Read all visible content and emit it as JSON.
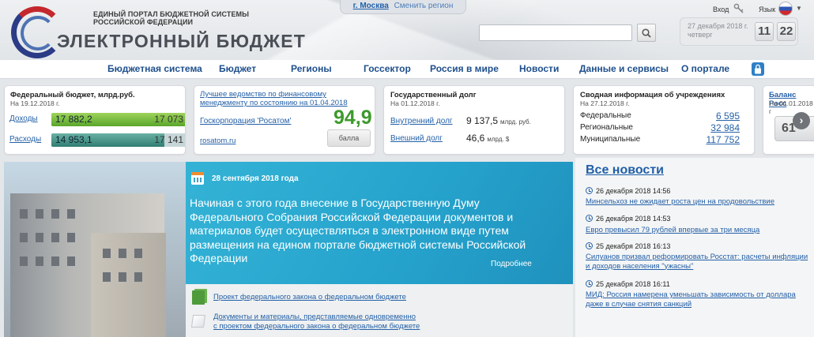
{
  "header": {
    "portal_line1": "ЕДИНЫЙ ПОРТАЛ БЮДЖЕТНОЙ СИСТЕМЫ",
    "portal_line2": "РОССИЙСКОЙ ФЕДЕРАЦИИ",
    "brand": "ЭЛЕКТРОННЫЙ БЮДЖЕТ",
    "region_city": "г. Москва",
    "region_change": "Сменить регион",
    "search_placeholder": "",
    "date": "27 декабря 2018 г.",
    "weekday": "четверг",
    "clock_hours": "11",
    "clock_minutes": "22",
    "login": "Вход",
    "language": "Язык",
    "icons": [
      "search-icon",
      "key-icon",
      "flag-icon",
      "lock-icon"
    ]
  },
  "nav": {
    "items": [
      "Бюджетная система",
      "Бюджет",
      "Регионы",
      "Госсектор",
      "Россия в мире",
      "Новости",
      "Данные и сервисы",
      "О портале"
    ]
  },
  "cards": {
    "federal": {
      "title": "Федеральный бюджет, млрд.руб.",
      "date": "На 19.12.2018 г.",
      "income_label": "Доходы",
      "income_actual": "17 882,2",
      "income_plan": "17 073",
      "income_fill_pct": 100,
      "expense_label": "Расходы",
      "expense_actual": "14 953,1",
      "expense_plan": "17 141",
      "expense_fill_pct": 83
    },
    "ministry": {
      "title": "Лучшее ведомство по финансовому менеджменту по состоянию на 01.04.2018",
      "org": "Госкорпорация 'Росатом'",
      "score": "94,9",
      "score_unit": "балла",
      "site": "rosatom.ru"
    },
    "debt": {
      "title": "Государственный долг",
      "date": "На 01.12.2018 г.",
      "internal_label": "Внутренний долг",
      "internal_value": "9 137,5",
      "internal_unit": "млрд. руб.",
      "external_label": "Внешний долг",
      "external_value": "46,6",
      "external_unit": "млрд. $"
    },
    "institutions": {
      "title": "Сводная информация об учреждениях",
      "date": "На 27.12.2018 г.",
      "rows": [
        {
          "label": "Федеральные",
          "value": "6 595"
        },
        {
          "label": "Региональные",
          "value": "32 984"
        },
        {
          "label": "Муниципальные",
          "value": "117 752"
        }
      ]
    },
    "balance": {
      "title": "Баланс Росс",
      "date": "На 01.01.2018 г",
      "digits": "61",
      "next_arrow": "›"
    }
  },
  "banner": {
    "date": "28 сентября 2018 года",
    "text": "Начиная с этого года внесение в Государственную Думу Федерального Собрания Российской Федерации документов и материалов будет осуществляться в электронном виде путем размещения на едином портале бюджетной системы Российской Федерации",
    "more": "Подробнее"
  },
  "documents": {
    "link1": "Проект федерального закона о федеральном бюджете",
    "link2_line1": "Документы и материалы, представляемые одновременно",
    "link2_line2": "с проектом федерального закона о федеральном бюджете"
  },
  "news": {
    "heading": "Все новости",
    "items": [
      {
        "time": "26 декабря 2018 14:56",
        "title": "Минсельхоз не ожидает роста цен на продовольствие"
      },
      {
        "time": "26 декабря 2018 14:53",
        "title": "Евро превысил 79 рублей впервые за три месяца"
      },
      {
        "time": "25 декабря 2018 16:13",
        "title": "Силуанов призвал реформировать Росстат: расчеты инфляции и доходов населения \"ужасны\""
      },
      {
        "time": "25 декабря 2018 16:11",
        "title": "МИД: Россия намерена уменьшать зависимость от доллара даже в случае снятия санкций"
      }
    ]
  },
  "colors": {
    "nav_text": "#1e4f8c",
    "link": "#2561a8",
    "banner_bg": "#25a2cc",
    "score_green": "#3d9a2c",
    "income_bar": "#5aa62b",
    "expense_bar": "#2f7d72"
  }
}
